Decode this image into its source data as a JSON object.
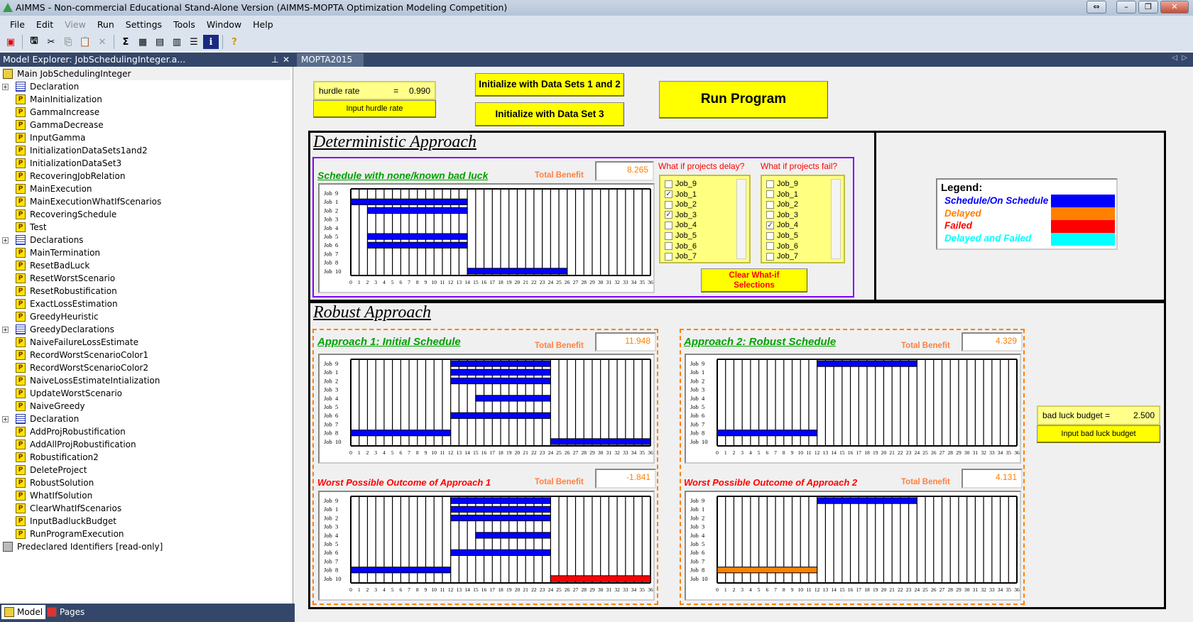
{
  "window": {
    "title": "AIMMS - Non-commercial Educational Stand-Alone Version (AIMMS-MOPTA Optimization Modeling Competition)"
  },
  "menu": [
    {
      "label": "File",
      "enabled": true
    },
    {
      "label": "Edit",
      "enabled": true
    },
    {
      "label": "View",
      "enabled": false
    },
    {
      "label": "Run",
      "enabled": true
    },
    {
      "label": "Settings",
      "enabled": true
    },
    {
      "label": "Tools",
      "enabled": true
    },
    {
      "label": "Window",
      "enabled": true
    },
    {
      "label": "Help",
      "enabled": true
    }
  ],
  "toolbar": [
    "calendar-icon",
    "save-all-icon",
    "cut-icon",
    "copy-icon",
    "paste-icon",
    "delete-icon",
    "math-program-icon",
    "data-page-icon",
    "page-manager-icon",
    "template-manager-icon",
    "menu-builder-icon",
    "identifier-info-icon",
    "help-icon"
  ],
  "explorer": {
    "title": "Model Explorer: JobSchedulingInteger.a...",
    "items": [
      {
        "label": "Main JobSchedulingInteger",
        "type": "main",
        "level": 0
      },
      {
        "label": "Declaration",
        "type": "decl",
        "level": 1
      },
      {
        "label": "MainInitialization",
        "type": "proc",
        "level": 1
      },
      {
        "label": "GammaIncrease",
        "type": "proc",
        "level": 1
      },
      {
        "label": "GammaDecrease",
        "type": "proc",
        "level": 1
      },
      {
        "label": "InputGamma",
        "type": "proc",
        "level": 1
      },
      {
        "label": "InitializationDataSets1and2",
        "type": "proc",
        "level": 1
      },
      {
        "label": "InitializationDataSet3",
        "type": "proc",
        "level": 1
      },
      {
        "label": "RecoveringJobRelation",
        "type": "proc",
        "level": 1
      },
      {
        "label": "MainExecution",
        "type": "proc",
        "level": 1
      },
      {
        "label": "MainExecutionWhatIfScenarios",
        "type": "proc",
        "level": 1
      },
      {
        "label": "RecoveringSchedule",
        "type": "proc",
        "level": 1
      },
      {
        "label": "Test",
        "type": "proc",
        "level": 1
      },
      {
        "label": "Declarations",
        "type": "decl",
        "level": 1
      },
      {
        "label": "MainTermination",
        "type": "proc",
        "level": 1
      },
      {
        "label": "ResetBadLuck",
        "type": "proc",
        "level": 1
      },
      {
        "label": "ResetWorstScenario",
        "type": "proc",
        "level": 1
      },
      {
        "label": "ResetRobustification",
        "type": "proc",
        "level": 1
      },
      {
        "label": "ExactLossEstimation",
        "type": "proc",
        "level": 1
      },
      {
        "label": "GreedyHeuristic",
        "type": "proc",
        "level": 1
      },
      {
        "label": "GreedyDeclarations",
        "type": "decl",
        "level": 1
      },
      {
        "label": "NaiveFailureLossEstimate",
        "type": "proc",
        "level": 1
      },
      {
        "label": "RecordWorstScenarioColor1",
        "type": "proc",
        "level": 1
      },
      {
        "label": "RecordWorstScenarioColor2",
        "type": "proc",
        "level": 1
      },
      {
        "label": "NaiveLossEstimateIntialization",
        "type": "proc",
        "level": 1
      },
      {
        "label": "UpdateWorstScenario",
        "type": "proc",
        "level": 1
      },
      {
        "label": "NaiveGreedy",
        "type": "proc",
        "level": 1
      },
      {
        "label": "Declaration",
        "type": "decl",
        "level": 1
      },
      {
        "label": "AddProjRobustification",
        "type": "proc",
        "level": 1
      },
      {
        "label": "AddAllProjRobustification",
        "type": "proc",
        "level": 1
      },
      {
        "label": "Robustification2",
        "type": "proc",
        "level": 1
      },
      {
        "label": "DeleteProject",
        "type": "proc",
        "level": 1
      },
      {
        "label": "RobustSolution",
        "type": "proc",
        "level": 1
      },
      {
        "label": "WhatIfSolution",
        "type": "proc",
        "level": 1
      },
      {
        "label": "ClearWhatIfScenarios",
        "type": "proc",
        "level": 1
      },
      {
        "label": "InputBadluckBudget",
        "type": "proc",
        "level": 1
      },
      {
        "label": "RunProgramExecution",
        "type": "proc",
        "level": 1
      },
      {
        "label": "Predeclared Identifiers [read-only]",
        "type": "ro",
        "level": 0
      }
    ],
    "tabs": [
      {
        "label": "Model"
      },
      {
        "label": "Pages"
      }
    ]
  },
  "page_tab": {
    "label": "MOPTA2015"
  },
  "controls": {
    "hurdle_label": "hurdle rate",
    "hurdle_eq": "=",
    "hurdle_value": "0.990",
    "hurdle_button": "Input hurdle rate",
    "init12_button": "Initialize with Data Sets 1 and 2",
    "init3_button": "Initialize with Data Set 3",
    "run_button": "Run Program",
    "budget_label": "bad luck budget =",
    "budget_value": "2.500",
    "budget_button": "Input bad luck budget"
  },
  "deterministic": {
    "title": "Deterministic Approach",
    "schedule_title": "Schedule with none/known bad luck",
    "benefit_label": "Total Benefit",
    "benefit_value": "8.265",
    "delay_question": "What if projects delay?",
    "fail_question": "What if projects fail?",
    "delay_options": [
      {
        "label": "Job_9",
        "checked": false
      },
      {
        "label": "Job_1",
        "checked": true
      },
      {
        "label": "Job_2",
        "checked": false
      },
      {
        "label": "Job_3",
        "checked": true
      },
      {
        "label": "Job_4",
        "checked": false
      },
      {
        "label": "Job_5",
        "checked": false
      },
      {
        "label": "Job_6",
        "checked": false
      },
      {
        "label": "Job_7",
        "checked": false
      }
    ],
    "fail_options": [
      {
        "label": "Job_9",
        "checked": false
      },
      {
        "label": "Job_1",
        "checked": false
      },
      {
        "label": "Job_2",
        "checked": false
      },
      {
        "label": "Job_3",
        "checked": false
      },
      {
        "label": "Job_4",
        "checked": true
      },
      {
        "label": "Job_5",
        "checked": false
      },
      {
        "label": "Job_6",
        "checked": false
      },
      {
        "label": "Job_7",
        "checked": false
      }
    ],
    "clear_button_line1": "Clear What-if",
    "clear_button_line2": "Selections"
  },
  "legend": {
    "title": "Legend:",
    "items": [
      {
        "label": "Schedule/On Schedule",
        "color": "#0000ff"
      },
      {
        "label": "Delayed",
        "color": "#ff8000"
      },
      {
        "label": "Failed",
        "color": "#ff0000"
      },
      {
        "label": "Delayed and Failed",
        "color": "#00ffff"
      }
    ]
  },
  "robust": {
    "title": "Robust Approach",
    "a1_title": "Approach 1: Initial Schedule",
    "a1_benefit_label": "Total Benefit",
    "a1_benefit": "11.948",
    "a1w_title": "Worst Possible Outcome of Approach 1",
    "a1w_benefit_label": "Total Benefit",
    "a1w_benefit": "-1.841",
    "a2_title": "Approach 2: Robust Schedule",
    "a2_benefit_label": "Total Benefit",
    "a2_benefit": "4.329",
    "a2w_title": "Worst Possible Outcome of Approach 2",
    "a2w_benefit_label": "Total Benefit",
    "a2w_benefit": "4.131"
  },
  "chart_data": [
    {
      "id": "det",
      "type": "gantt",
      "rows": [
        "Job 9",
        "Job 1",
        "Job 2",
        "Job 3",
        "Job 4",
        "Job 5",
        "Job 6",
        "Job 7",
        "Job 8",
        "Job 10"
      ],
      "xlim": [
        0,
        36
      ],
      "bars": [
        {
          "row": "Job 1",
          "start": 0,
          "end": 14,
          "color": "#0000ff"
        },
        {
          "row": "Job 2",
          "start": 2,
          "end": 14,
          "color": "#0000ff"
        },
        {
          "row": "Job 5",
          "start": 2,
          "end": 14,
          "color": "#0000ff"
        },
        {
          "row": "Job 6",
          "start": 2,
          "end": 14,
          "color": "#0000ff"
        },
        {
          "row": "Job 10",
          "start": 14,
          "end": 26,
          "color": "#0000ff"
        }
      ]
    },
    {
      "id": "a1",
      "type": "gantt",
      "rows": [
        "Job 9",
        "Job 1",
        "Job 2",
        "Job 3",
        "Job 4",
        "Job 5",
        "Job 6",
        "Job 7",
        "Job 8",
        "Job 10"
      ],
      "xlim": [
        0,
        36
      ],
      "bars": [
        {
          "row": "Job 9",
          "start": 12,
          "end": 24,
          "color": "#0000ff"
        },
        {
          "row": "Job 1",
          "start": 12,
          "end": 24,
          "color": "#0000ff"
        },
        {
          "row": "Job 2",
          "start": 12,
          "end": 24,
          "color": "#0000ff"
        },
        {
          "row": "Job 4",
          "start": 15,
          "end": 24,
          "color": "#0000ff"
        },
        {
          "row": "Job 6",
          "start": 12,
          "end": 24,
          "color": "#0000ff"
        },
        {
          "row": "Job 8",
          "start": 0,
          "end": 12,
          "color": "#0000ff"
        },
        {
          "row": "Job 10",
          "start": 24,
          "end": 36,
          "color": "#0000ff"
        }
      ]
    },
    {
      "id": "a1w",
      "type": "gantt",
      "rows": [
        "Job 9",
        "Job 1",
        "Job 2",
        "Job 3",
        "Job 4",
        "Job 5",
        "Job 6",
        "Job 7",
        "Job 8",
        "Job 10"
      ],
      "xlim": [
        0,
        36
      ],
      "bars": [
        {
          "row": "Job 9",
          "start": 12,
          "end": 24,
          "color": "#0000ff"
        },
        {
          "row": "Job 1",
          "start": 12,
          "end": 24,
          "color": "#0000ff"
        },
        {
          "row": "Job 2",
          "start": 12,
          "end": 24,
          "color": "#0000ff"
        },
        {
          "row": "Job 4",
          "start": 15,
          "end": 24,
          "color": "#0000ff"
        },
        {
          "row": "Job 6",
          "start": 12,
          "end": 24,
          "color": "#0000ff"
        },
        {
          "row": "Job 8",
          "start": 0,
          "end": 12,
          "color": "#0000ff"
        },
        {
          "row": "Job 10",
          "start": 24,
          "end": 36,
          "color": "#ff0000"
        }
      ]
    },
    {
      "id": "a2",
      "type": "gantt",
      "rows": [
        "Job 9",
        "Job 1",
        "Job 2",
        "Job 3",
        "Job 4",
        "Job 5",
        "Job 6",
        "Job 7",
        "Job 8",
        "Job 10"
      ],
      "xlim": [
        0,
        36
      ],
      "bars": [
        {
          "row": "Job 9",
          "start": 12,
          "end": 24,
          "color": "#0000ff"
        },
        {
          "row": "Job 8",
          "start": 0,
          "end": 12,
          "color": "#0000ff"
        }
      ]
    },
    {
      "id": "a2w",
      "type": "gantt",
      "rows": [
        "Job 9",
        "Job 1",
        "Job 2",
        "Job 3",
        "Job 4",
        "Job 5",
        "Job 6",
        "Job 7",
        "Job 8",
        "Job 10"
      ],
      "xlim": [
        0,
        36
      ],
      "bars": [
        {
          "row": "Job 9",
          "start": 12,
          "end": 24,
          "color": "#0000ff"
        },
        {
          "row": "Job 8",
          "start": 0,
          "end": 12,
          "color": "#ff8000"
        }
      ]
    }
  ]
}
